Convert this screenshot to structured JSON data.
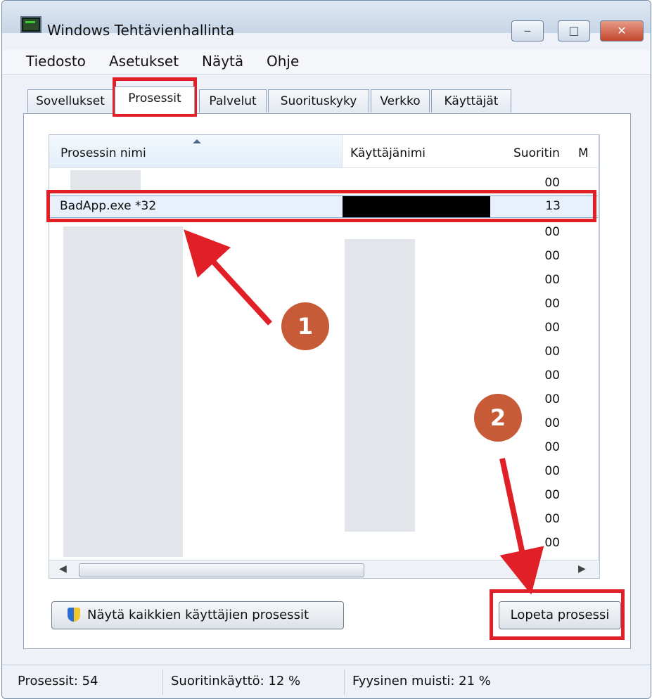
{
  "window": {
    "title": "Windows Tehtävienhallinta",
    "buttons": [
      "‒",
      "□",
      "✕"
    ]
  },
  "menu": [
    "Tiedosto",
    "Asetukset",
    "Näytä",
    "Ohje"
  ],
  "tabs": [
    "Sovellukset",
    "Prosessit",
    "Palvelut",
    "Suorituskyky",
    "Verkko",
    "Käyttäjät"
  ],
  "columns": [
    "Prosessin nimi",
    "Käyttäjänimi",
    "Suoritin",
    "M"
  ],
  "rows": [
    {
      "name": "",
      "user": "",
      "cpu": "00"
    },
    {
      "name": "BadApp.exe *32",
      "user": "",
      "cpu": "13"
    },
    {
      "name": "",
      "user": "",
      "cpu": "00"
    },
    {
      "name": "",
      "user": "",
      "cpu": "00"
    },
    {
      "name": "",
      "user": "",
      "cpu": "00"
    },
    {
      "name": "",
      "user": "",
      "cpu": "00"
    },
    {
      "name": "",
      "user": "",
      "cpu": "00"
    },
    {
      "name": "",
      "user": "",
      "cpu": "00"
    },
    {
      "name": "",
      "user": "",
      "cpu": "00"
    },
    {
      "name": "",
      "user": "",
      "cpu": "00"
    },
    {
      "name": "",
      "user": "",
      "cpu": "00"
    },
    {
      "name": "",
      "user": "",
      "cpu": "00"
    },
    {
      "name": "",
      "user": "",
      "cpu": "00"
    },
    {
      "name": "",
      "user": "",
      "cpu": "00"
    },
    {
      "name": "",
      "user": "",
      "cpu": "00"
    },
    {
      "name": "",
      "user": "",
      "cpu": "00"
    }
  ],
  "buttons": {
    "show_all": "Näytä kaikkien käyttäjien prosessit",
    "end_process": "Lopeta prosessi"
  },
  "status": {
    "processes": "Prosessit: 54",
    "cpu": "Suoritinkäyttö: 12 %",
    "memory": "Fyysinen muisti: 21 %"
  },
  "annotations": {
    "step1": "1",
    "step2": "2"
  },
  "colors": {
    "highlight": "#e11f26",
    "badge": "#c75a37"
  },
  "icons": [
    "task-manager-icon",
    "minimize-icon",
    "maximize-icon",
    "close-icon",
    "sort-up-icon",
    "uac-shield-icon"
  ]
}
